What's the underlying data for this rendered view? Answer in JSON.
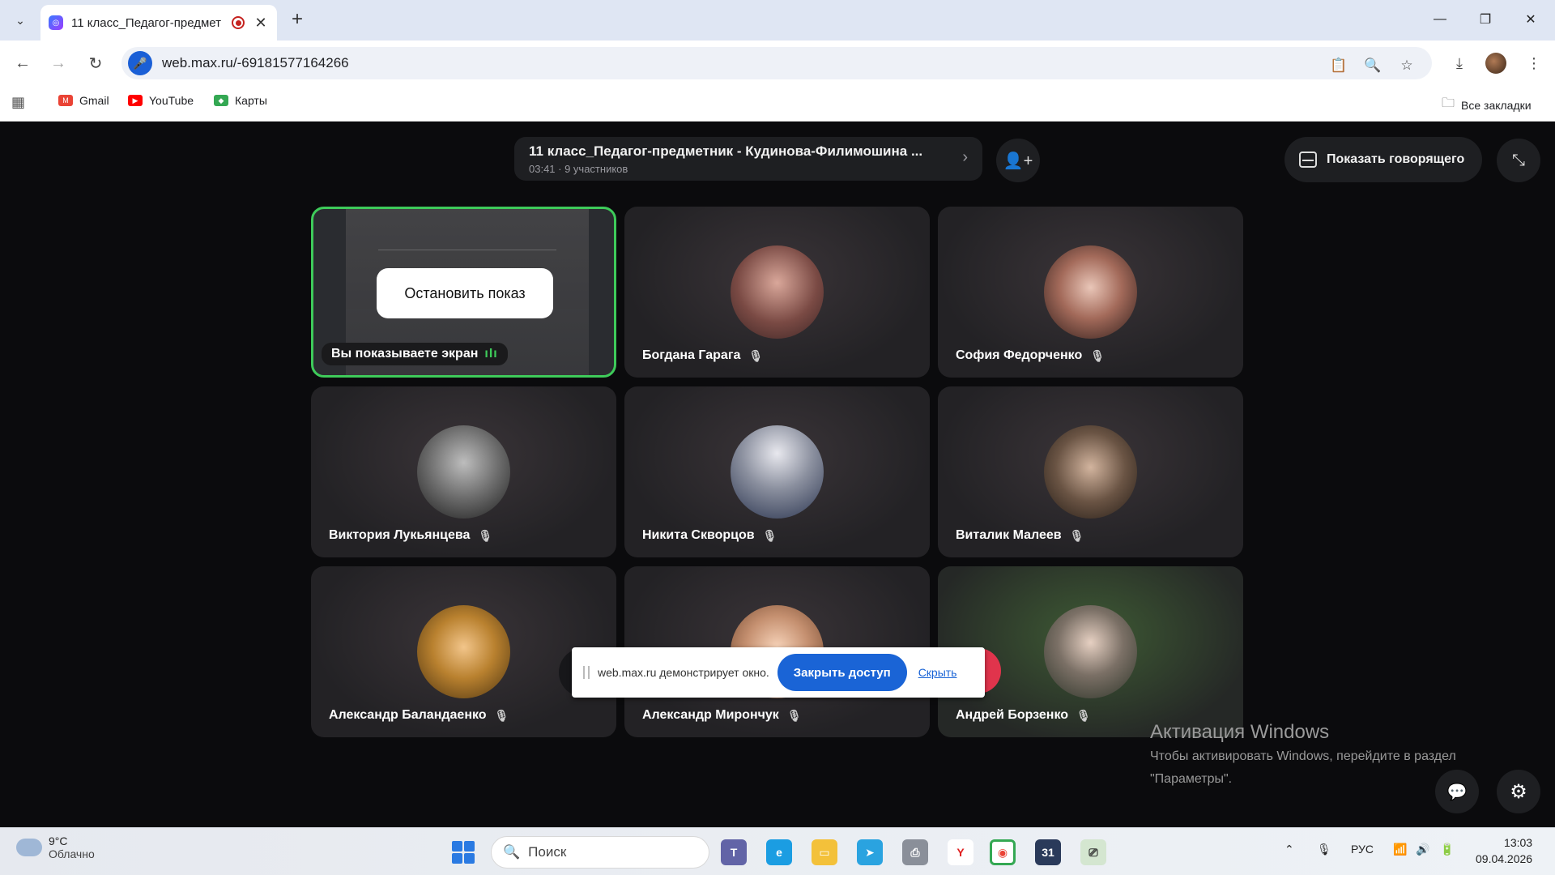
{
  "browser": {
    "tab_title": "11 класс_Педагог-предмет",
    "new_tab": "+",
    "url": "web.max.ru/-69181577164266",
    "bookmarks": [
      {
        "label": "Gmail",
        "color": "#ea4335"
      },
      {
        "label": "YouTube",
        "color": "#ff0000"
      },
      {
        "label": "Карты",
        "color": "#34a853"
      }
    ],
    "all_bookmarks": "Все закладки"
  },
  "meeting": {
    "title": "11 класс_Педагог-предметник - Кудинова-Филимошина ...",
    "subtitle": "03:41 · 9 участников",
    "show_speaker": "Показать говорящего",
    "stop_share": "Остановить показ",
    "self_label": "Вы показываете экран",
    "participants": [
      {
        "name": "Богдана Гарага"
      },
      {
        "name": "София Федорченко"
      },
      {
        "name": "Виктория Лукьянцева"
      },
      {
        "name": "Никита Скворцов"
      },
      {
        "name": "Виталик Малеев"
      },
      {
        "name": "Александр Баландаенко"
      },
      {
        "name": "Александр Мирончук"
      },
      {
        "name": "Андрей Борзенко"
      }
    ]
  },
  "share_notice": {
    "text": "web.max.ru демонстрирует окно.",
    "close": "Закрыть доступ",
    "hide": "Скрыть"
  },
  "activation": {
    "title": "Активация Windows",
    "line1": "Чтобы активировать Windows, перейдите в раздел",
    "line2": "\"Параметры\"."
  },
  "taskbar": {
    "temp": "9°C",
    "condition": "Облачно",
    "search": "Поиск",
    "lang": "РУС",
    "time": "13:03",
    "date": "09.04.2026"
  }
}
